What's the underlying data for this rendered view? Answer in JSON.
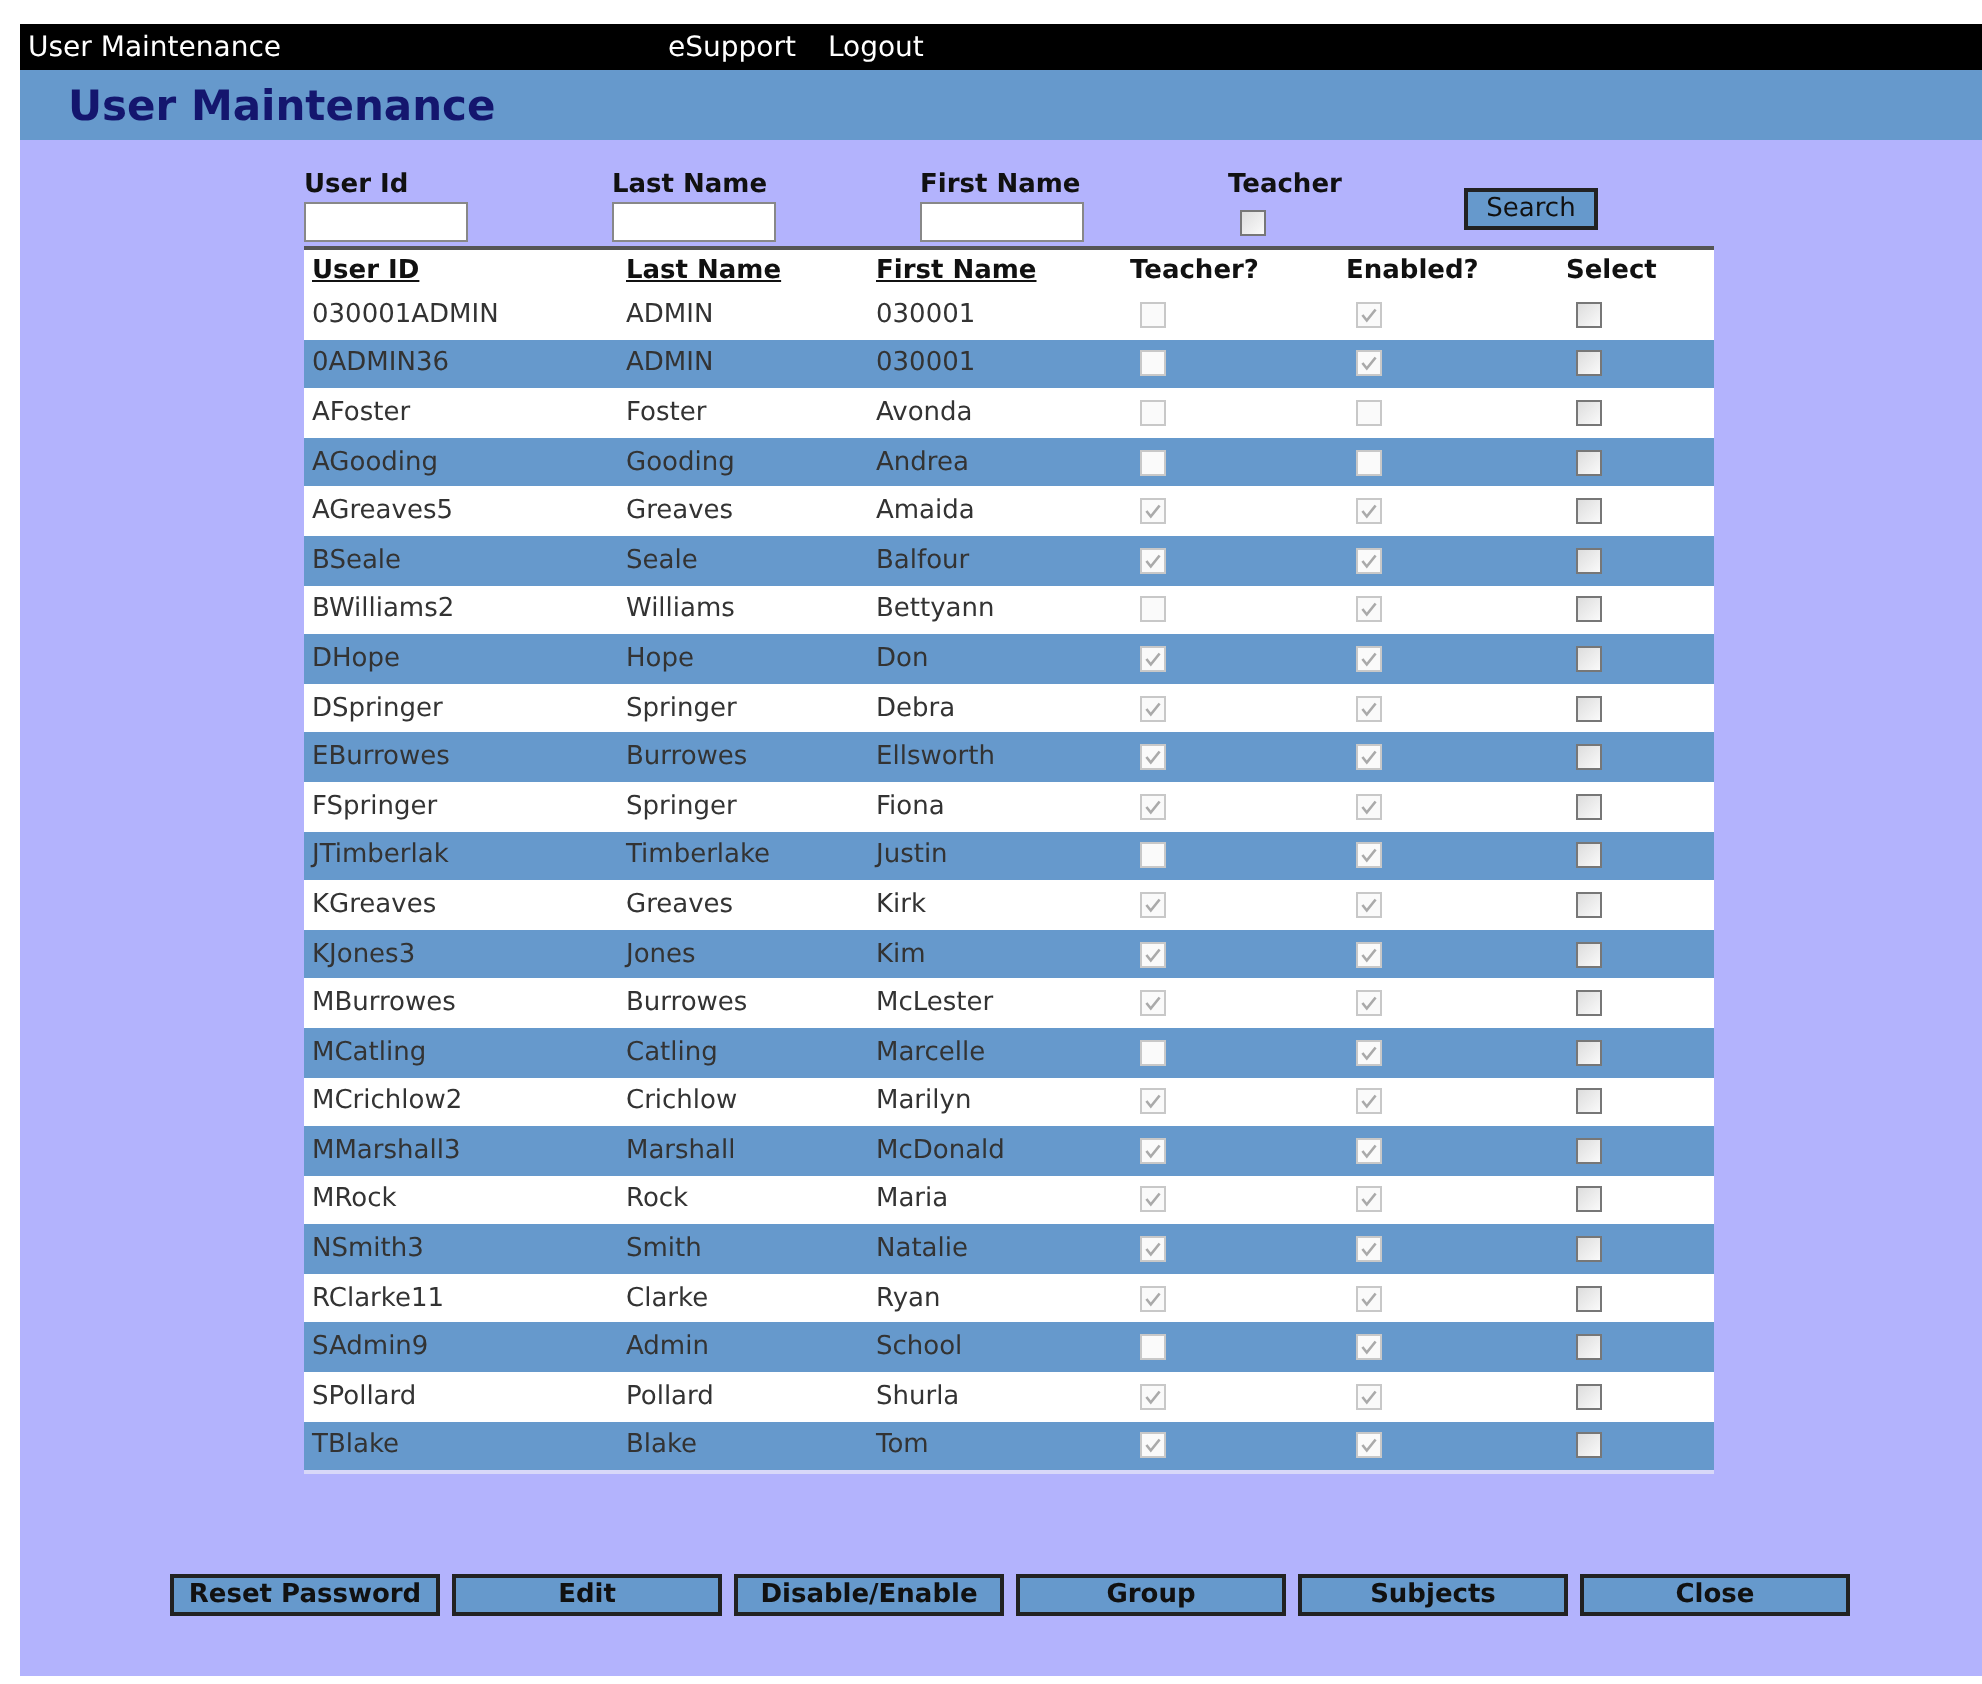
{
  "top_bar": {
    "title": "User Maintenance",
    "links": [
      "eSupport",
      "Logout"
    ]
  },
  "page_title": "User Maintenance",
  "filters": {
    "fields": [
      {
        "label": "User Id"
      },
      {
        "label": "Last Name"
      },
      {
        "label": "First Name"
      }
    ],
    "teacher": {
      "label": "Teacher",
      "checked": false
    },
    "search_button": "Search"
  },
  "table": {
    "columns": [
      "User ID",
      "Last Name",
      "First Name",
      "Teacher?",
      "Enabled?",
      "Select"
    ],
    "rows": [
      {
        "user_id": "030001ADMIN",
        "last_name": "ADMIN",
        "first_name": "030001",
        "teacher": false,
        "enabled": true,
        "selected": false
      },
      {
        "user_id": "0ADMIN36",
        "last_name": "ADMIN",
        "first_name": "030001",
        "teacher": false,
        "enabled": true,
        "selected": false
      },
      {
        "user_id": "AFoster",
        "last_name": "Foster",
        "first_name": "Avonda",
        "teacher": false,
        "enabled": false,
        "selected": false
      },
      {
        "user_id": "AGooding",
        "last_name": "Gooding",
        "first_name": "Andrea",
        "teacher": false,
        "enabled": false,
        "selected": false
      },
      {
        "user_id": "AGreaves5",
        "last_name": "Greaves",
        "first_name": "Amaida",
        "teacher": true,
        "enabled": true,
        "selected": false
      },
      {
        "user_id": "BSeale",
        "last_name": "Seale",
        "first_name": "Balfour",
        "teacher": true,
        "enabled": true,
        "selected": false
      },
      {
        "user_id": "BWilliams2",
        "last_name": "Williams",
        "first_name": "Bettyann",
        "teacher": false,
        "enabled": true,
        "selected": false
      },
      {
        "user_id": "DHope",
        "last_name": "Hope",
        "first_name": "Don",
        "teacher": true,
        "enabled": true,
        "selected": false
      },
      {
        "user_id": "DSpringer",
        "last_name": "Springer",
        "first_name": "Debra",
        "teacher": true,
        "enabled": true,
        "selected": false
      },
      {
        "user_id": "EBurrowes",
        "last_name": "Burrowes",
        "first_name": "Ellsworth",
        "teacher": true,
        "enabled": true,
        "selected": false
      },
      {
        "user_id": "FSpringer",
        "last_name": "Springer",
        "first_name": "Fiona",
        "teacher": true,
        "enabled": true,
        "selected": false
      },
      {
        "user_id": "JTimberlak",
        "last_name": "Timberlake",
        "first_name": "Justin",
        "teacher": false,
        "enabled": true,
        "selected": false
      },
      {
        "user_id": "KGreaves",
        "last_name": "Greaves",
        "first_name": "Kirk",
        "teacher": true,
        "enabled": true,
        "selected": false
      },
      {
        "user_id": "KJones3",
        "last_name": "Jones",
        "first_name": "Kim",
        "teacher": true,
        "enabled": true,
        "selected": false
      },
      {
        "user_id": "MBurrowes",
        "last_name": "Burrowes",
        "first_name": "McLester",
        "teacher": true,
        "enabled": true,
        "selected": false
      },
      {
        "user_id": "MCatling",
        "last_name": "Catling",
        "first_name": "Marcelle",
        "teacher": false,
        "enabled": true,
        "selected": false
      },
      {
        "user_id": "MCrichlow2",
        "last_name": "Crichlow",
        "first_name": "Marilyn",
        "teacher": true,
        "enabled": true,
        "selected": false
      },
      {
        "user_id": "MMarshall3",
        "last_name": "Marshall",
        "first_name": "McDonald",
        "teacher": true,
        "enabled": true,
        "selected": false
      },
      {
        "user_id": "MRock",
        "last_name": "Rock",
        "first_name": "Maria",
        "teacher": true,
        "enabled": true,
        "selected": false
      },
      {
        "user_id": "NSmith3",
        "last_name": "Smith",
        "first_name": "Natalie",
        "teacher": true,
        "enabled": true,
        "selected": false
      },
      {
        "user_id": "RClarke11",
        "last_name": "Clarke",
        "first_name": "Ryan",
        "teacher": true,
        "enabled": true,
        "selected": false
      },
      {
        "user_id": "SAdmin9",
        "last_name": "Admin",
        "first_name": "School",
        "teacher": false,
        "enabled": true,
        "selected": false
      },
      {
        "user_id": "SPollard",
        "last_name": "Pollard",
        "first_name": "Shurla",
        "teacher": true,
        "enabled": true,
        "selected": false
      },
      {
        "user_id": "TBlake",
        "last_name": "Blake",
        "first_name": "Tom",
        "teacher": true,
        "enabled": true,
        "selected": false
      }
    ]
  },
  "buttons": [
    "Reset Password",
    "Edit",
    "Disable/Enable",
    "Group",
    "Subjects",
    "Close"
  ]
}
